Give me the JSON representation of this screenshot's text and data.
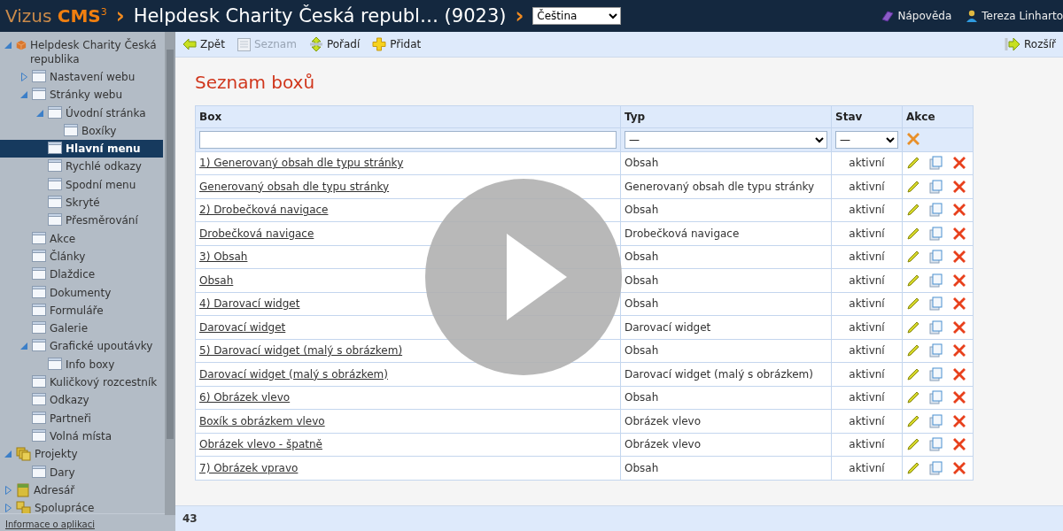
{
  "header": {
    "logo": "Vizus **CMS**$^{3}$",
    "separator_1": "›",
    "title": "Helpdesk Charity Česká republ… (9023)",
    "separator_2": "›",
    "language": "Čeština",
    "help": "Nápověda",
    "user": "Tereza Linharto"
  },
  "sidebar": {
    "tree": [
      {
        "label": "Helpdesk Charity Česká republika",
        "kind": "site",
        "expanded": true,
        "selected": false,
        "children": [
          {
            "label": "Nastavení webu",
            "kind": "page",
            "expanded": false,
            "selected": false
          },
          {
            "label": "Stránky webu",
            "kind": "page",
            "expanded": true,
            "selected": false,
            "children": [
              {
                "label": "Úvodní stránka",
                "kind": "page",
                "expanded": true,
                "selected": false,
                "children": [
                  {
                    "label": "Boxíky",
                    "kind": "page",
                    "selected": false
                  }
                ]
              },
              {
                "label": "Hlavní menu",
                "kind": "page",
                "selected": true
              },
              {
                "label": "Rychlé odkazy",
                "kind": "page",
                "selected": false
              },
              {
                "label": "Spodní menu",
                "kind": "page",
                "selected": false
              },
              {
                "label": "Skryté",
                "kind": "page",
                "selected": false
              },
              {
                "label": "Přesměrování",
                "kind": "page",
                "selected": false
              }
            ]
          },
          {
            "label": "Akce",
            "kind": "page",
            "selected": false
          },
          {
            "label": "Články",
            "kind": "page",
            "selected": false
          },
          {
            "label": "Dlaždice",
            "kind": "page",
            "selected": false
          },
          {
            "label": "Dokumenty",
            "kind": "page",
            "selected": false
          },
          {
            "label": "Formuláře",
            "kind": "page",
            "selected": false
          },
          {
            "label": "Galerie",
            "kind": "page",
            "selected": false
          },
          {
            "label": "Grafické upoutávky",
            "kind": "page",
            "expanded": true,
            "selected": false,
            "children": [
              {
                "label": "Info boxy",
                "kind": "page",
                "selected": false
              }
            ]
          },
          {
            "label": "Kuličkový rozcestník",
            "kind": "page",
            "selected": false
          },
          {
            "label": "Odkazy",
            "kind": "page",
            "selected": false
          },
          {
            "label": "Partneři",
            "kind": "page",
            "selected": false
          },
          {
            "label": "Volná místa",
            "kind": "page",
            "selected": false
          }
        ]
      },
      {
        "label": "Projekty",
        "kind": "projects",
        "expanded": true,
        "selected": false,
        "children": [
          {
            "label": "Dary",
            "kind": "page",
            "selected": false
          }
        ]
      },
      {
        "label": "Adresář",
        "kind": "addressbook",
        "expanded": false,
        "selected": false
      },
      {
        "label": "Spolupráce",
        "kind": "collab",
        "expanded": false,
        "selected": false
      }
    ],
    "footer_link": "Informace o aplikaci"
  },
  "toolbar": {
    "buttons": [
      {
        "label": "Zpět",
        "kind": "back",
        "disabled": false
      },
      {
        "label": "Seznam",
        "kind": "list",
        "disabled": true
      },
      {
        "label": "Pořadí",
        "kind": "order",
        "disabled": false
      },
      {
        "label": "Přidat",
        "kind": "add",
        "disabled": false
      }
    ],
    "right_button": {
      "label": "Rozšíř",
      "kind": "expand",
      "disabled": false
    }
  },
  "page_title": "Seznam boxů",
  "table": {
    "columns": [
      "Box",
      "Typ",
      "Stav",
      "Akce"
    ],
    "filters": {
      "typ": "—",
      "stav": "—"
    },
    "rows": [
      {
        "box": "1) Generovaný obsah dle typu stránky",
        "typ": "Obsah",
        "stav": "aktivní"
      },
      {
        "box": "Generovaný obsah dle typu stránky",
        "typ": "Generovaný obsah dle typu stránky",
        "stav": "aktivní"
      },
      {
        "box": "2) Drobečková navigace",
        "typ": "Obsah",
        "stav": "aktivní"
      },
      {
        "box": "Drobečková navigace",
        "typ": "Drobečková navigace",
        "stav": "aktivní"
      },
      {
        "box": "3) Obsah",
        "typ": "Obsah",
        "stav": "aktivní"
      },
      {
        "box": "Obsah",
        "typ": "Obsah",
        "stav": "aktivní"
      },
      {
        "box": "4) Darovací widget",
        "typ": "Obsah",
        "stav": "aktivní"
      },
      {
        "box": "Darovací widget",
        "typ": "Darovací widget",
        "stav": "aktivní"
      },
      {
        "box": "5) Darovací widget (malý s obrázkem)",
        "typ": "Obsah",
        "stav": "aktivní"
      },
      {
        "box": "Darovací widget (malý s obrázkem)",
        "typ": "Darovací widget (malý s obrázkem)",
        "stav": "aktivní"
      },
      {
        "box": "6) Obrázek vlevo",
        "typ": "Obsah",
        "stav": "aktivní"
      },
      {
        "box": "Boxík s obrázkem vlevo",
        "typ": "Obrázek vlevo",
        "stav": "aktivní"
      },
      {
        "box": "Obrázek vlevo - špatně",
        "typ": "Obrázek vlevo",
        "stav": "aktivní"
      },
      {
        "box": "7) Obrázek vpravo",
        "typ": "Obsah",
        "stav": "aktivní"
      }
    ],
    "total": "43"
  }
}
